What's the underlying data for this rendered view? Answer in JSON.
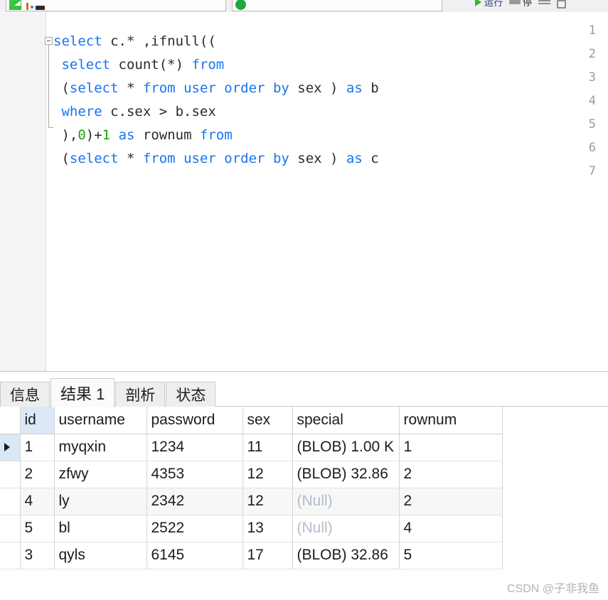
{
  "toolbar": {
    "tabs": [
      {
        "label": "",
        "icon": "green-sheet-icon"
      },
      {
        "label": "",
        "icon": "green-circle-icon"
      }
    ],
    "run_label": "运行",
    "run_icon": "play-triangle-icon",
    "stop_label": "停",
    "stop_icon": "stop-bar-icon",
    "explain_icon": "lines-icon",
    "panel_icon": "panel-box-icon"
  },
  "editor": {
    "line_numbers": [
      "1",
      "2",
      "3",
      "4",
      "5",
      "6",
      "7"
    ],
    "fold_marker": "collapse-minus-icon",
    "lines": [
      [
        {
          "t": "select",
          "c": "kw"
        },
        {
          "t": " c.* ,ifnull((",
          "c": "pl"
        }
      ],
      [
        {
          "t": " ",
          "c": "pl"
        },
        {
          "t": "select",
          "c": "kw"
        },
        {
          "t": " count(*) ",
          "c": "pl"
        },
        {
          "t": "from",
          "c": "kw"
        }
      ],
      [
        {
          "t": " (",
          "c": "pl"
        },
        {
          "t": "select",
          "c": "kw"
        },
        {
          "t": " * ",
          "c": "pl"
        },
        {
          "t": "from",
          "c": "kw"
        },
        {
          "t": " ",
          "c": "pl"
        },
        {
          "t": "user",
          "c": "kw"
        },
        {
          "t": " ",
          "c": "pl"
        },
        {
          "t": "order",
          "c": "kw"
        },
        {
          "t": " ",
          "c": "pl"
        },
        {
          "t": "by",
          "c": "kw"
        },
        {
          "t": " sex ) ",
          "c": "pl"
        },
        {
          "t": "as",
          "c": "kw"
        },
        {
          "t": " b",
          "c": "pl"
        }
      ],
      [
        {
          "t": " ",
          "c": "pl"
        },
        {
          "t": "where",
          "c": "kw"
        },
        {
          "t": " c.sex > b.sex",
          "c": "pl"
        }
      ],
      [
        {
          "t": " ),",
          "c": "pl"
        },
        {
          "t": "0",
          "c": "num"
        },
        {
          "t": ")+",
          "c": "pl"
        },
        {
          "t": "1",
          "c": "num"
        },
        {
          "t": " ",
          "c": "pl"
        },
        {
          "t": "as",
          "c": "kw"
        },
        {
          "t": " rownum ",
          "c": "pl"
        },
        {
          "t": "from",
          "c": "kw"
        }
      ],
      [
        {
          "t": " (",
          "c": "pl"
        },
        {
          "t": "select",
          "c": "kw"
        },
        {
          "t": " * ",
          "c": "pl"
        },
        {
          "t": "from",
          "c": "kw"
        },
        {
          "t": " ",
          "c": "pl"
        },
        {
          "t": "user",
          "c": "kw"
        },
        {
          "t": " ",
          "c": "pl"
        },
        {
          "t": "order",
          "c": "kw"
        },
        {
          "t": " ",
          "c": "pl"
        },
        {
          "t": "by",
          "c": "kw"
        },
        {
          "t": " sex ) ",
          "c": "pl"
        },
        {
          "t": "as",
          "c": "kw"
        },
        {
          "t": " c",
          "c": "pl"
        }
      ],
      []
    ]
  },
  "result_pane": {
    "tabs": [
      {
        "label": "信息",
        "active": false
      },
      {
        "label": "结果 1",
        "active": true
      },
      {
        "label": "剖析",
        "active": false
      },
      {
        "label": "状态",
        "active": false
      }
    ],
    "grid": {
      "selected_column": "id",
      "selected_row_index": 0,
      "row_marker_icon": "current-row-arrow-icon",
      "columns": [
        "id",
        "username",
        "password",
        "sex",
        "special",
        "rownum"
      ],
      "rows": [
        {
          "id": "1",
          "username": "myqxin",
          "password": "1234",
          "sex": "11",
          "special": "(BLOB) 1.00 K",
          "special_null": false,
          "rownum": "1"
        },
        {
          "id": "2",
          "username": "zfwy",
          "password": "4353",
          "sex": "12",
          "special": "(BLOB) 32.86",
          "special_null": false,
          "rownum": "2"
        },
        {
          "id": "4",
          "username": "ly",
          "password": "2342",
          "sex": "12",
          "special": "(Null)",
          "special_null": true,
          "rownum": "2"
        },
        {
          "id": "5",
          "username": "bl",
          "password": "2522",
          "sex": "13",
          "special": "(Null)",
          "special_null": true,
          "rownum": "4"
        },
        {
          "id": "3",
          "username": "qyls",
          "password": "6145",
          "sex": "17",
          "special": "(BLOB) 32.86",
          "special_null": false,
          "rownum": "5"
        }
      ]
    }
  },
  "watermark": "CSDN @子非我鱼",
  "colors": {
    "keyword": "#1874ee",
    "number": "#12a50a",
    "selection": "#dae7f5",
    "header_selected": "#dce8f6",
    "gutter": "#f4f4f4",
    "null_text": "#b3bdcc"
  }
}
